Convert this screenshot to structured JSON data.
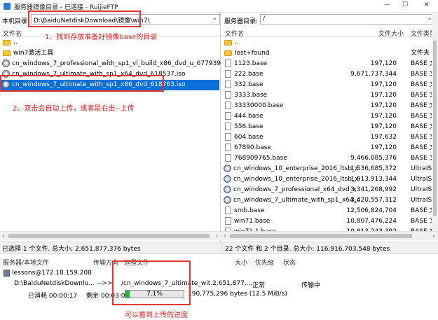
{
  "window": {
    "title": "服务器镜像目录 - 已连接 - RuijieFTP",
    "min": "—",
    "max": "☐",
    "close": "✕"
  },
  "local": {
    "path_label": "本机目录:",
    "path_value": "D:\\BaiduNetdiskDownload\\镜像\\win7\\",
    "col_name": "文件名",
    "items": [
      {
        "type": "folder",
        "name": ".."
      },
      {
        "type": "folder",
        "name": "win7激活工具"
      },
      {
        "type": "iso",
        "name": "cn_windows_7_professional_with_sp1_vl_build_x86_dvd_u_677939.i..."
      },
      {
        "type": "iso",
        "name": "cn_windows_7_ultimate_with_sp1_x64_dvd_618537.iso"
      },
      {
        "type": "iso",
        "name": "cn_windows_7_ultimate_with_sp1_x86_dvd_618763.iso",
        "selected": true
      }
    ],
    "status": "已选择 1 个文件. 总大小: 2,651,877,376 bytes",
    "note1": "1、找到存放准备好镜像base的目录",
    "note2": "2、双击会自动上传，或者是右击--上传"
  },
  "server": {
    "path_label": "服务器目录:",
    "path_value": "/",
    "col_name": "文件名",
    "col_size": "文件大小",
    "col_type": "文件类型",
    "items": [
      {
        "type": "folder",
        "name": "..",
        "size": "",
        "kind": ""
      },
      {
        "type": "folder",
        "name": "lost+found",
        "size": "",
        "kind": "文件夹"
      },
      {
        "type": "file",
        "name": "1123.base",
        "size": "197,120",
        "kind": "BASE 文件"
      },
      {
        "type": "file",
        "name": "222.base",
        "size": "9,671,737,344",
        "kind": "BASE 文件"
      },
      {
        "type": "file",
        "name": "332.base",
        "size": "197,120",
        "kind": "BASE 文件"
      },
      {
        "type": "file",
        "name": "3333.base",
        "size": "197,120",
        "kind": "BASE 文件"
      },
      {
        "type": "file",
        "name": "33330000.base",
        "size": "197,120",
        "kind": "BASE 文件"
      },
      {
        "type": "file",
        "name": "444.base",
        "size": "197,120",
        "kind": "BASE 文件"
      },
      {
        "type": "file",
        "name": "556.base",
        "size": "197,120",
        "kind": "BASE 文件"
      },
      {
        "type": "file",
        "name": "604.base",
        "size": "197,632",
        "kind": "BASE 文件"
      },
      {
        "type": "file",
        "name": "67890.base",
        "size": "197,120",
        "kind": "BASE 文件"
      },
      {
        "type": "file",
        "name": "768909765.base",
        "size": "9,466,085,376",
        "kind": "BASE 文件"
      },
      {
        "type": "iso",
        "name": "cn_windows_10_enterprise_2016_ltsb_x...",
        "size": "1,536,685,372",
        "kind": "UltraISO"
      },
      {
        "type": "iso",
        "name": "cn_windows_10_enterprise_2016_ltsb_x...",
        "size": "1,913,913,344",
        "kind": "UltraISO"
      },
      {
        "type": "iso",
        "name": "cn_windows_7_professional_x64_dvd_x...",
        "size": "3,341,268,992",
        "kind": "UltraISO"
      },
      {
        "type": "iso",
        "name": "cn_windows_7_ultimate_with_sp1_x64_d...",
        "size": "3,420,557,312",
        "kind": "UltraISO"
      },
      {
        "type": "file",
        "name": "smb.base",
        "size": "12,506,824,704",
        "kind": "BASE 文件"
      },
      {
        "type": "file",
        "name": "win71.base",
        "size": "10,807,476,224",
        "kind": "BASE 文件"
      },
      {
        "type": "file",
        "name": "win71.1.base",
        "size": "10,813,243,392",
        "kind": "BASE 文件"
      }
    ],
    "status": "22 个文件 和 2 个目录. 总大小: 116,916,703,548 bytes"
  },
  "queue": {
    "h_server": "服务器/本地文件",
    "h_dir": "传输方向",
    "h_remote": "远程文件",
    "h_size": "大小",
    "h_prio": "优先级",
    "h_status": "状态",
    "server": "lessons@172.18.159.208",
    "local_file": "D:\\BaiduNetdiskDownlo...",
    "direction": "-->>",
    "remote_file": "/cn_windows_7_ultimate_wit...",
    "size": "2,651,877,...",
    "priority": "正常",
    "status": "传输中",
    "elapsed": "已消耗 00:00:17",
    "remaining": "剩余 00:03:09",
    "progress_text": "7.1%",
    "progress_value": 7.1,
    "bytes": "190,775,296 bytes (12.5 MiB/s)",
    "note3": "可以看到上传的进度"
  }
}
